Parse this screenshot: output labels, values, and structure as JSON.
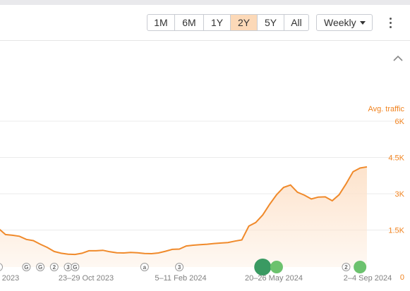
{
  "toolbar": {
    "ranges": [
      "1M",
      "6M",
      "1Y",
      "2Y",
      "5Y",
      "All"
    ],
    "active_range": "2Y",
    "interval": "Weekly"
  },
  "colors": {
    "line": "#f08a2b",
    "fill": "#fde3cc",
    "label": "#f0821e",
    "active_button": "#fcd9b8",
    "marker_dark": "#3a9a62",
    "marker_light": "#6cc26e"
  },
  "icons": {
    "more": "vertical-dots-icon",
    "collapse": "chevron-up-icon",
    "interval": "caret-down-icon"
  },
  "chart_data": {
    "type": "area",
    "series_label": "Avg. traffic",
    "y_ticks": [
      "6K",
      "4.5K",
      "3K",
      "1.5K",
      "0"
    ],
    "ylim": [
      0,
      6000
    ],
    "x_ticks": [
      "2023",
      "23–29 Oct 2023",
      "5–11 Feb 2024",
      "20–26 May 2024",
      "2–4 Sep 2024"
    ],
    "grid": true,
    "x": [
      "2023-08-28",
      "2023-09-04",
      "2023-09-11",
      "2023-09-18",
      "2023-09-25",
      "2023-10-02",
      "2023-10-09",
      "2023-10-16",
      "2023-10-23",
      "2023-10-30",
      "2023-11-06",
      "2023-11-13",
      "2023-11-20",
      "2023-11-27",
      "2023-12-04",
      "2023-12-11",
      "2023-12-18",
      "2023-12-25",
      "2024-01-01",
      "2024-01-08",
      "2024-01-15",
      "2024-01-22",
      "2024-01-29",
      "2024-02-05",
      "2024-02-12",
      "2024-02-19",
      "2024-02-26",
      "2024-03-04",
      "2024-03-11",
      "2024-03-18",
      "2024-03-25",
      "2024-04-01",
      "2024-04-08",
      "2024-04-15",
      "2024-04-22",
      "2024-04-29",
      "2024-05-06",
      "2024-05-13",
      "2024-05-20",
      "2024-05-27",
      "2024-06-03",
      "2024-06-10",
      "2024-06-17",
      "2024-06-24",
      "2024-07-01",
      "2024-07-08",
      "2024-07-15",
      "2024-07-22",
      "2024-07-29",
      "2024-08-05",
      "2024-08-12",
      "2024-08-19",
      "2024-08-26",
      "2024-09-02"
    ],
    "values": [
      2000,
      1750,
      1720,
      1680,
      1550,
      1500,
      1350,
      1220,
      1050,
      980,
      940,
      930,
      980,
      1080,
      1080,
      1100,
      1040,
      1000,
      990,
      1010,
      1000,
      970,
      960,
      990,
      1060,
      1140,
      1150,
      1280,
      1310,
      1330,
      1350,
      1380,
      1400,
      1420,
      1480,
      1530,
      2100,
      2250,
      2560,
      3000,
      3400,
      3700,
      3800,
      3500,
      3380,
      3220,
      3300,
      3310,
      3150,
      3400,
      3850,
      4350,
      4500,
      4550
    ],
    "events": [
      {
        "date": "2023-08-28",
        "label": "a"
      },
      {
        "date": "2023-09-25",
        "label": "G"
      },
      {
        "date": "2023-10-09",
        "label": "G"
      },
      {
        "date": "2023-10-23",
        "label": "2"
      },
      {
        "date": "2023-11-06",
        "label": "3"
      },
      {
        "date": "2023-11-13",
        "label": "G"
      },
      {
        "date": "2024-01-22",
        "label": "a"
      },
      {
        "date": "2024-02-26",
        "label": "3"
      },
      {
        "date": "2024-05-20",
        "label": "",
        "kind": "big-dark"
      },
      {
        "date": "2024-06-03",
        "label": "",
        "kind": "big-light"
      },
      {
        "date": "2024-08-12",
        "label": "2"
      },
      {
        "date": "2024-08-26",
        "label": "",
        "kind": "big-light"
      }
    ]
  }
}
